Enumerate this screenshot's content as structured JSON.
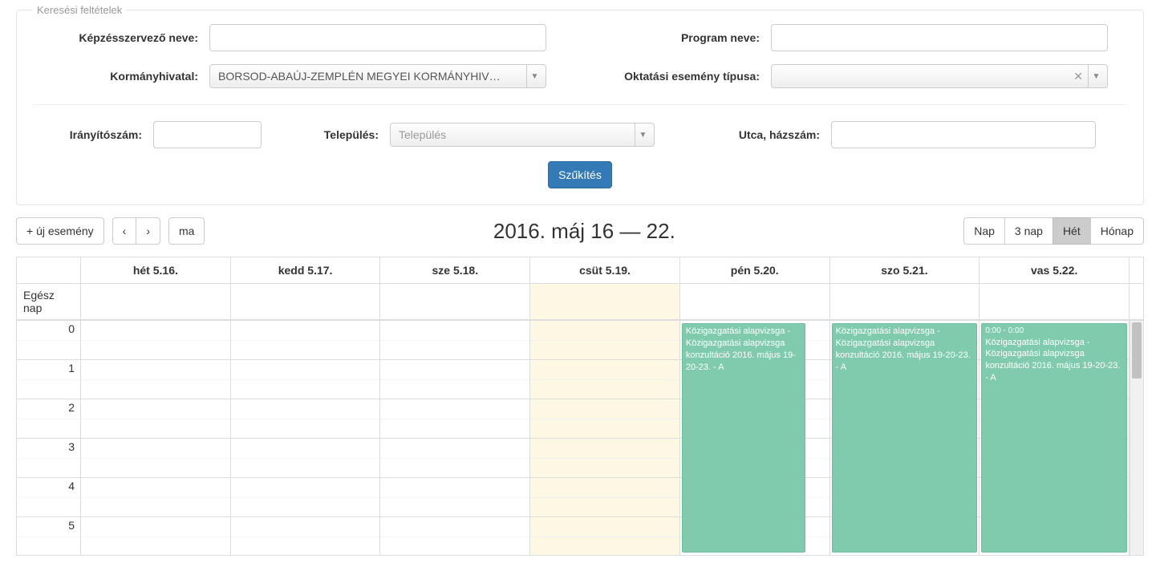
{
  "fieldset_legend": "Keresési feltételek",
  "labels": {
    "organizer": "Képzésszervező neve:",
    "program": "Program neve:",
    "office": "Kormányhivatal:",
    "event_type": "Oktatási esemény típusa:",
    "zip": "Irányítószám:",
    "city": "Település:",
    "street": "Utca, házszám:"
  },
  "inputs": {
    "organizer": "",
    "program": "",
    "office_selected": "BORSOD-ABAÚJ-ZEMPLÉN MEGYEI KORMÁNYHIV…",
    "event_type_selected": "",
    "zip": "",
    "city_placeholder": "Település",
    "street": ""
  },
  "buttons": {
    "filter": "Szűkítés",
    "new_event": "+ új esemény",
    "today": "ma"
  },
  "calendar": {
    "title": "2016. máj 16 — 22.",
    "views": {
      "day": "Nap",
      "three_day": "3 nap",
      "week": "Hét",
      "month": "Hónap"
    },
    "active_view": "week",
    "allday_label": "Egész nap",
    "today_col_index": 3,
    "day_headers": [
      "hét 5.16.",
      "kedd 5.17.",
      "sze 5.18.",
      "csüt 5.19.",
      "pén 5.20.",
      "szo 5.21.",
      "vas 5.22."
    ],
    "hours": [
      "0",
      "1",
      "2",
      "3",
      "4",
      "5"
    ],
    "events": [
      {
        "day_index": 4,
        "time_label": "",
        "title": "Közigazgatási alapvizsga - Közigazgatási alapvizsga konzultáció 2016. május 19-20-23. - A"
      },
      {
        "day_index": 5,
        "time_label": "",
        "title": "Közigazgatási alapvizsga - Közigazgatási alapvizsga konzultáció 2016. május 19-20-23. - A"
      },
      {
        "day_index": 6,
        "time_label": "0:00 - 0:00",
        "title": "Közigazgatási alapvizsga - Közigazgatási alapvizsga konzultáció 2016. május 19-20-23. - A"
      }
    ]
  }
}
